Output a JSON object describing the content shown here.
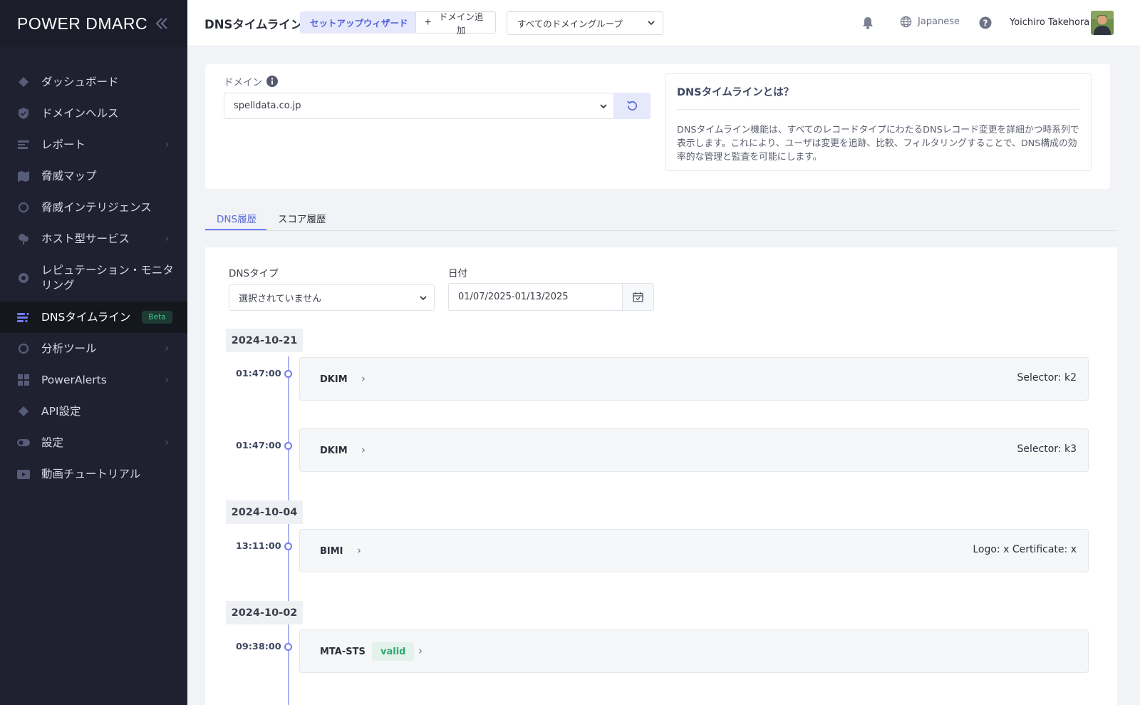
{
  "sidebar": {
    "logo": "POWER DMARC",
    "items": [
      {
        "label": "ダッシュボード",
        "icon": "diamond-icon",
        "chevron": false
      },
      {
        "label": "ドメインヘルス",
        "icon": "shield-check-icon",
        "chevron": false
      },
      {
        "label": "レポート",
        "icon": "report-icon",
        "chevron": true
      },
      {
        "label": "脅威マップ",
        "icon": "map-icon",
        "chevron": false
      },
      {
        "label": "脅威インテリジェンス",
        "icon": "circle-icon",
        "chevron": false
      },
      {
        "label": "ホスト型サービス",
        "icon": "cloud-icon",
        "chevron": true
      },
      {
        "label": "レピュテーション・モニタリング",
        "icon": "badge-icon",
        "chevron": false
      },
      {
        "label": "DNSタイムライン",
        "icon": "timeline-icon",
        "chevron": false,
        "active": true,
        "badge": "Beta"
      },
      {
        "label": "分析ツール",
        "icon": "circle-icon",
        "chevron": true
      },
      {
        "label": "PowerAlerts",
        "icon": "grid-icon",
        "chevron": true
      },
      {
        "label": "API設定",
        "icon": "diamond-icon",
        "chevron": false
      },
      {
        "label": "設定",
        "icon": "toggle-icon",
        "chevron": true
      },
      {
        "label": "動画チュートリアル",
        "icon": "video-icon",
        "chevron": false
      }
    ]
  },
  "header": {
    "title": "DNSタイムライン",
    "wizard_label": "セットアップウィザード",
    "add_domain_label": "ドメイン追加",
    "group_select": "すべてのドメイングループ",
    "language": "Japanese",
    "username": "Yoichiro Takehora"
  },
  "domain_card": {
    "label": "ドメイン",
    "domain_value": "spelldata.co.jp",
    "info_title": "DNSタイムラインとは？",
    "info_text": "DNSタイムライン機能は、すべてのレコードタイプにわたるDNSレコード変更を詳細かつ時系列で表示します。これにより、ユーザは変更を追跡、比較、フィルタリングすることで、DNS構成の効率的な管理と監査を可能にします。"
  },
  "tabs": [
    {
      "label": "DNS履歴",
      "active": true
    },
    {
      "label": "スコア履歴",
      "active": false
    }
  ],
  "filters": {
    "dns_type_label": "DNSタイプ",
    "dns_type_value": "選択されていません",
    "date_label": "日付",
    "date_value": "01/07/2025-01/13/2025"
  },
  "timeline": {
    "dates": [
      "2024-10-21",
      "2024-10-04",
      "2024-10-02"
    ],
    "entries": [
      {
        "time": "01:47:00",
        "type": "DKIM",
        "detail": "Selector: k2"
      },
      {
        "time": "01:47:00",
        "type": "DKIM",
        "detail": "Selector: k3"
      },
      {
        "time": "13:11:00",
        "type": "BIMI",
        "detail": "Logo: x Certificate: x"
      },
      {
        "time": "09:38:00",
        "type": "MTA-STS",
        "detail": "",
        "status": "valid"
      }
    ]
  },
  "colors": {
    "accent": "#6f7df3",
    "sidebar_bg": "#1f2130",
    "valid_green": "#2fa66e"
  }
}
